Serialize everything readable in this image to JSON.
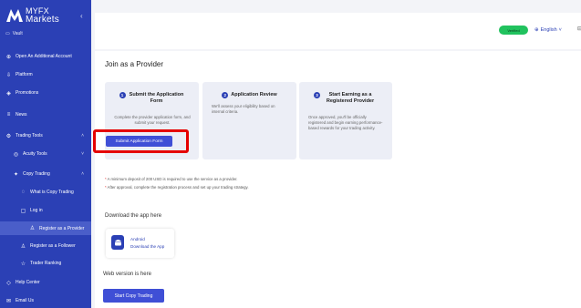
{
  "brand": {
    "line1": "MYFX",
    "line2": "Markets"
  },
  "sidebar": {
    "small_label": "Vault",
    "items": [
      {
        "label": "Open An Additional Account",
        "icon": "person-add-icon"
      },
      {
        "label": "Platform",
        "icon": "download-icon"
      },
      {
        "label": "Promotions",
        "icon": "gift-icon"
      },
      {
        "label": "News",
        "icon": "news-icon"
      },
      {
        "label": "Trading Tools",
        "icon": "tools-icon"
      },
      {
        "label": "Acuity Tools",
        "icon": "acuity-icon"
      },
      {
        "label": "Copy Trading",
        "icon": "copy-icon"
      },
      {
        "label": "What is Copy Trading",
        "icon": "question-icon"
      },
      {
        "label": "Log in",
        "icon": "login-icon"
      },
      {
        "label": "Register as a Provider",
        "icon": "provider-icon"
      },
      {
        "label": "Register as a Follower",
        "icon": "follower-icon"
      },
      {
        "label": "Trader Ranking",
        "icon": "ranking-icon"
      },
      {
        "label": "Help Center",
        "icon": "help-icon"
      },
      {
        "label": "Email Us",
        "icon": "mail-icon"
      }
    ]
  },
  "topbar": {
    "pill": "Verified",
    "language": "English"
  },
  "main": {
    "title": "Join as a Provider",
    "steps": [
      {
        "num": "1",
        "title": "Submit the Application Form",
        "desc": "Complete the provider application form, and submit your request."
      },
      {
        "num": "2",
        "title": "Application Review",
        "desc": "We'll assess your eligibility based on internal criteria."
      },
      {
        "num": "3",
        "title": "Start Earning as a Registered Provider",
        "desc": "Once approved, you'll be officially registered and begin earning performance-based rewards for your trading activity."
      }
    ],
    "submit_button": "Submit Application Form",
    "notes": [
      "A minimum deposit of 200 USD is required to use the service as a provider.",
      "After approval, complete the registration process and set up your trading strategy."
    ],
    "download_title": "Download the app here",
    "app": {
      "name": "Android",
      "sub": "Download the App"
    },
    "web_title": "Web version is here",
    "copy_button": "Start Copy Trading"
  },
  "colors": {
    "sidebar": "#2b40b5",
    "accent": "#3f4fd6",
    "highlight": "#e50000",
    "status": "#21c25e"
  }
}
